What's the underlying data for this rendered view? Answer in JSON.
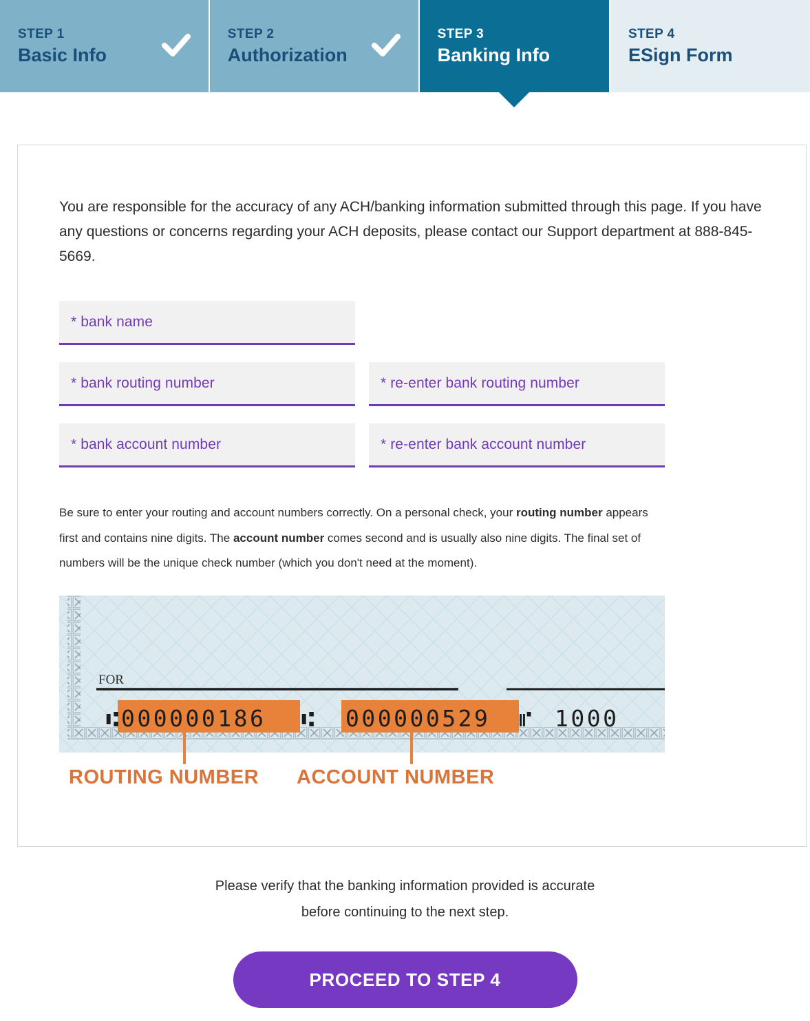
{
  "stepper": {
    "steps": [
      {
        "num": "STEP 1",
        "label": "Basic Info",
        "state": "done",
        "icon": "check-icon"
      },
      {
        "num": "STEP 2",
        "label": "Authorization",
        "state": "done",
        "icon": "check-icon"
      },
      {
        "num": "STEP 3",
        "label": "Banking Info",
        "state": "active",
        "icon": ""
      },
      {
        "num": "STEP 4",
        "label": "ESign Form",
        "state": "todo",
        "icon": ""
      }
    ]
  },
  "card": {
    "intro": "You are responsible for the accuracy of any ACH/banking information submitted through this page. If you have any questions or concerns regarding your ACH deposits, please contact our Support department at 888-845-5669.",
    "form": {
      "bank_name_placeholder": "* bank name",
      "routing_placeholder": "* bank routing number",
      "routing_confirm_placeholder": "* re-enter bank routing number",
      "account_placeholder": "* bank account number",
      "account_confirm_placeholder": "* re-enter bank account number",
      "bank_name_value": "",
      "routing_value": "",
      "routing_confirm_value": "",
      "account_value": "",
      "account_confirm_value": ""
    },
    "helper": {
      "part1": "Be sure to enter your routing and account numbers correctly. On a personal check, your ",
      "bold1": "routing number",
      "part2": " appears first and contains nine digits. The ",
      "bold2": "account number",
      "part3": " comes second and is usually also nine digits. The final set of numbers will be the unique check number (which you don't need at the moment)."
    },
    "check_image": {
      "for_label": "FOR",
      "micr_routing": "000000186",
      "micr_account": "000000529",
      "micr_check_number": "1000",
      "routing_caption": "ROUTING NUMBER",
      "account_caption": "ACCOUNT NUMBER"
    }
  },
  "footer": {
    "verify_line1": "Please verify that the banking information provided is accurate",
    "verify_line2": "before continuing to the next step.",
    "cta_label": "PROCEED TO STEP 4"
  },
  "colors": {
    "step_done": "#7FB2C8",
    "step_active": "#0A6E95",
    "step_todo": "#E3EDF2",
    "step_text_dark": "#1A4F7A",
    "field_bg": "#F1F1F1",
    "field_accent": "#6F3CB0",
    "placeholder": "#7339B5",
    "cta": "#7539C2",
    "check_bg": "#DCEAF0",
    "check_highlight": "#E8813A",
    "caption_orange": "#D9743B"
  }
}
